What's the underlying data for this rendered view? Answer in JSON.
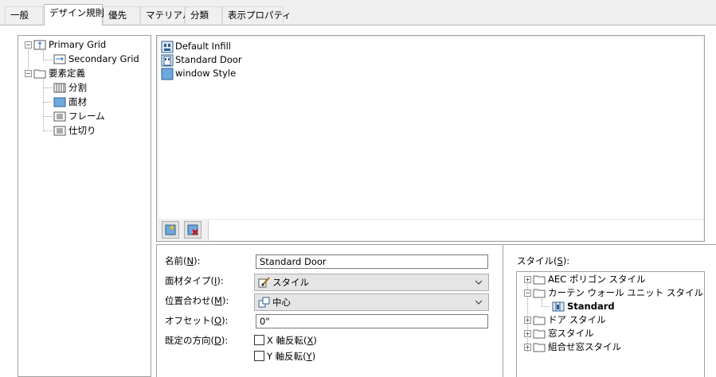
{
  "tabs": [
    "一般",
    "デザイン規則",
    "優先",
    "マテリアル",
    "分類",
    "表示プロパティ"
  ],
  "active_tab": "デザイン規則",
  "left_tree": {
    "primary_grid": "Primary Grid",
    "secondary_grid": "Secondary Grid",
    "element_definitions": "要素定義",
    "division": "分割",
    "infill": "面材",
    "frame": "フレーム",
    "mullion": "仕切り"
  },
  "infill_list": [
    "Default Infill",
    "Standard Door",
    "window Style"
  ],
  "form": {
    "name_label": "名前(",
    "name_key": "N",
    "name_value": "Standard Door",
    "infill_type_label": "面材タイプ(",
    "infill_type_key": "I",
    "infill_type_value": "スタイル",
    "alignment_label": "位置合わせ(",
    "alignment_key": "M",
    "alignment_value": "中心",
    "offset_label": "オフセット(",
    "offset_key": "O",
    "offset_value": "0\"",
    "orientation_label": "既定の方向(",
    "orientation_key": "D",
    "flip_x_label": "X 軸反転(",
    "flip_x_key": "X",
    "flip_y_label": "Y 軸反転(",
    "flip_y_key": "Y",
    "close_paren": "):",
    "close_paren_plain": ")"
  },
  "style_panel": {
    "label": "スタイル(",
    "key": "S",
    "items": [
      "AEC ポリゴン スタイル",
      "カーテン ウォール ユニット スタイル",
      "Standard",
      "ドア スタイル",
      "窓スタイル",
      "組合せ窓スタイル"
    ]
  },
  "icons": {
    "new_infill": "new-infill-icon",
    "delete_infill": "delete-infill-icon"
  }
}
